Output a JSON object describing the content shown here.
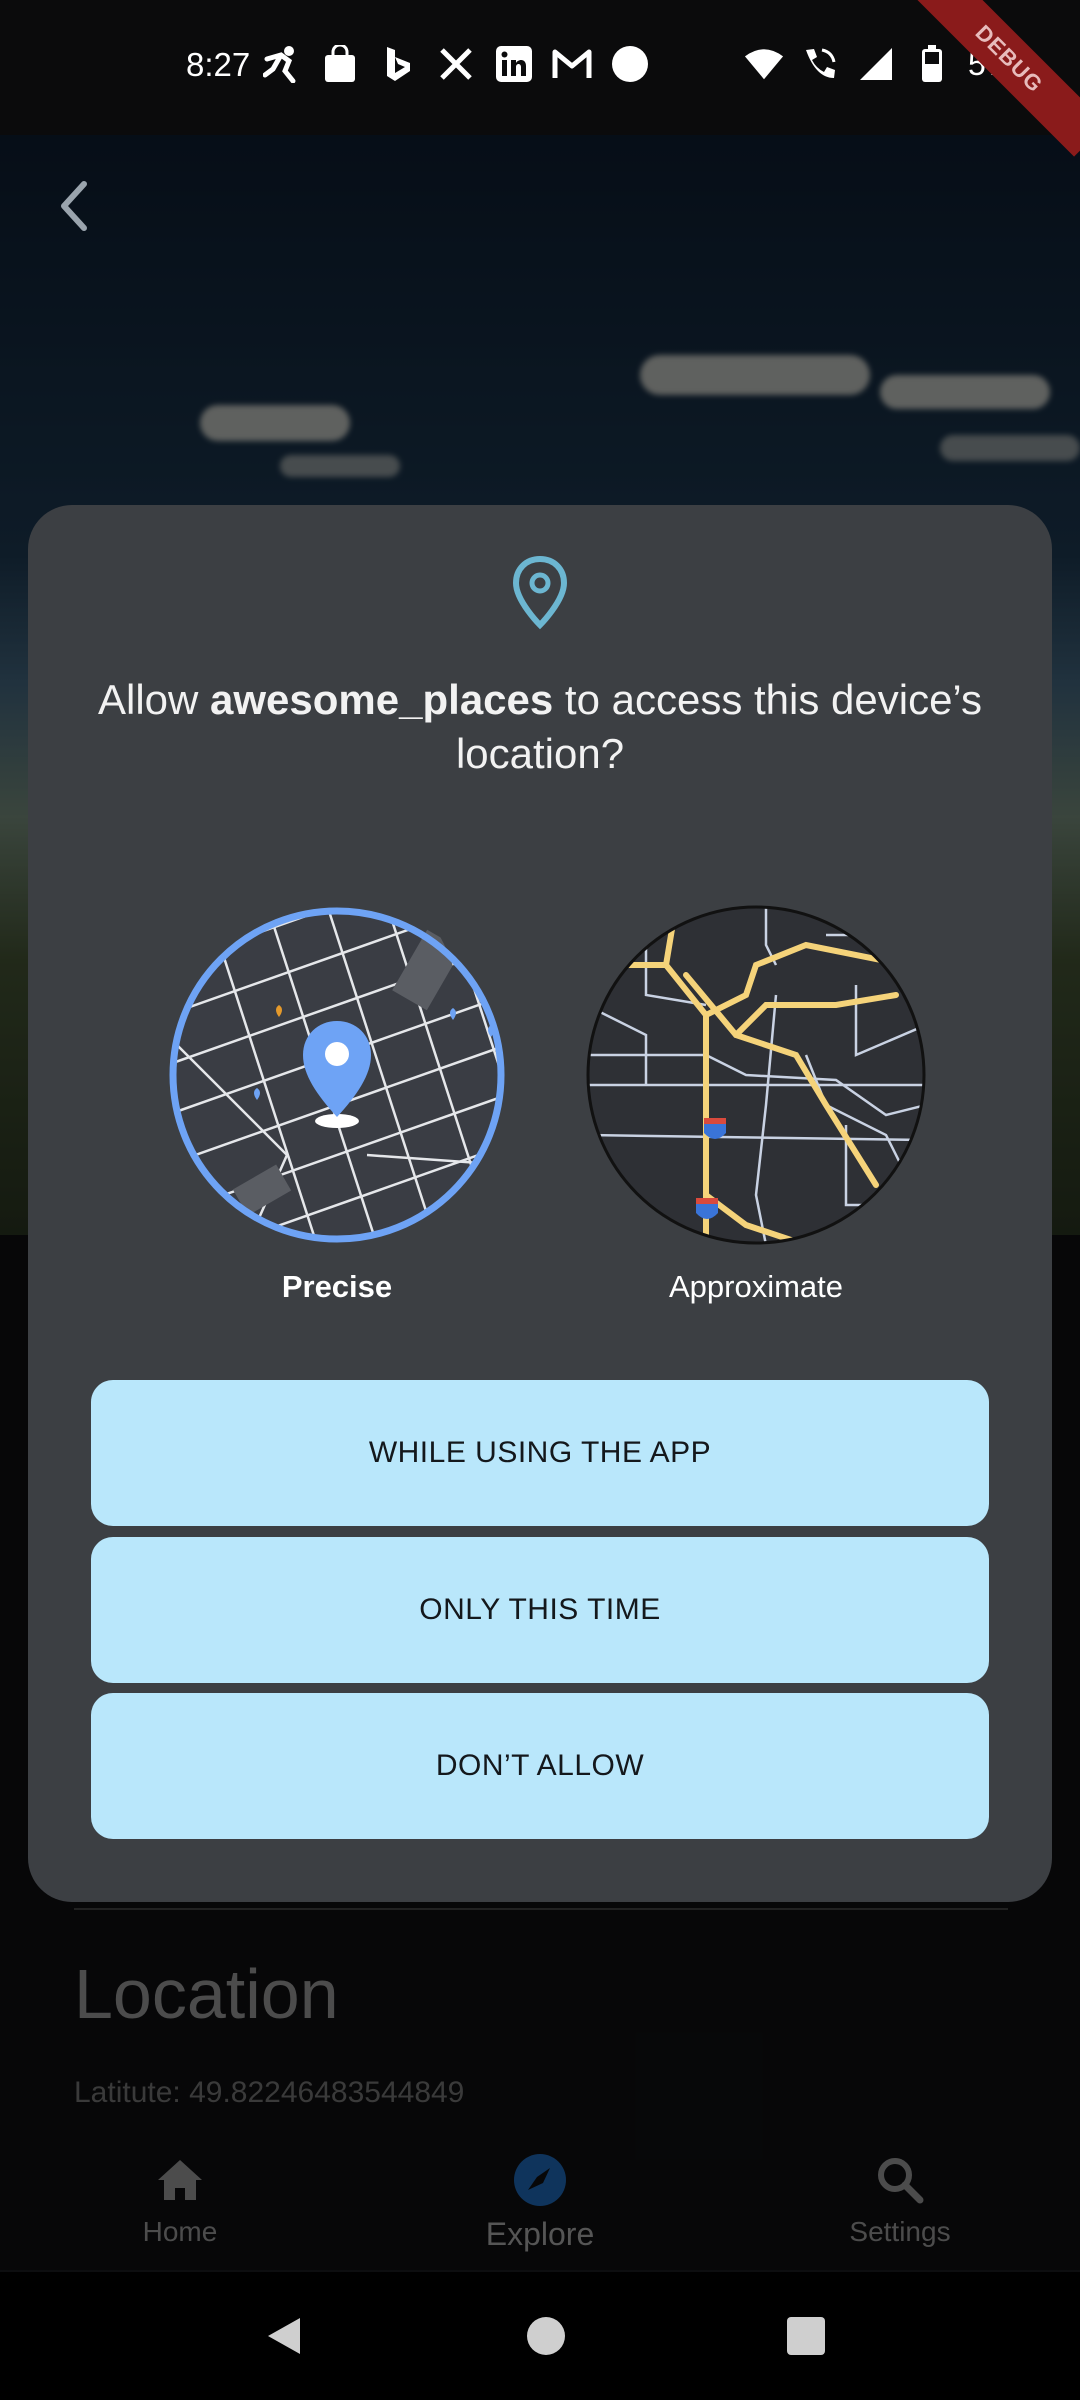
{
  "status_bar": {
    "time": "8:27",
    "battery": "57%",
    "debug_label": "DEBUG",
    "left_icons": [
      "activity-icon",
      "shopping-bag-icon",
      "bing-icon",
      "x-icon",
      "linkedin-icon",
      "gmail-icon",
      "circle-icon"
    ],
    "right_icons": [
      "wifi-icon",
      "wifi-calling-icon",
      "signal-icon",
      "battery-icon"
    ]
  },
  "dialog": {
    "title_pre": "Allow ",
    "app_name": "awesome_places",
    "title_post": " to access this device’s location?",
    "options": [
      {
        "label": "Precise",
        "selected": true
      },
      {
        "label": "Approximate",
        "selected": false
      }
    ],
    "buttons": {
      "while_using": "WHILE USING THE APP",
      "only_this_time": "ONLY THIS TIME",
      "dont_allow": "DON’T ALLOW"
    },
    "colors": {
      "accent": "#6ea3f5",
      "button_bg": "#b9e7fb",
      "pin": "#6cb6d1"
    }
  },
  "page": {
    "location_title": "Location",
    "latitude_text": "Latitute: 49.82246483544849"
  },
  "bottom_nav": {
    "items": [
      {
        "label": "Home",
        "icon": "home-icon",
        "active": false
      },
      {
        "label": "Explore",
        "icon": "explore-icon",
        "active": true
      },
      {
        "label": "Settings",
        "icon": "search-icon",
        "active": false
      }
    ]
  }
}
